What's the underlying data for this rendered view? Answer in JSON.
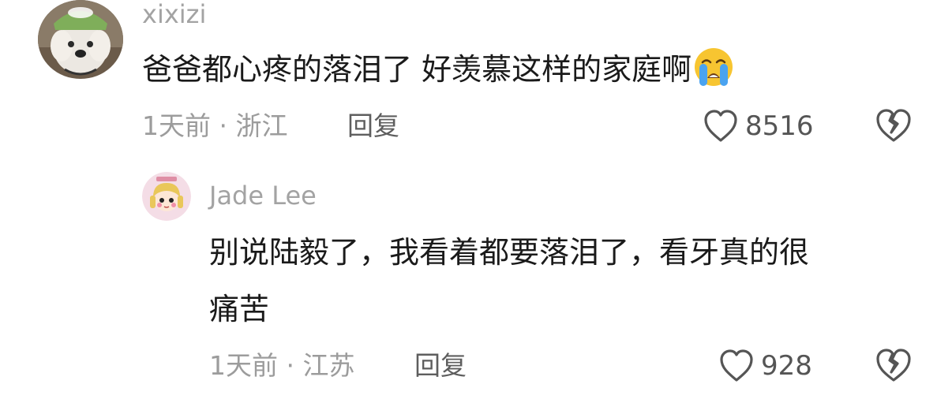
{
  "comments": [
    {
      "username": "xixizi",
      "text": "爸爸都心疼的落泪了 好羡慕这样的家庭啊",
      "emoji": "loudly-crying-face",
      "meta": "1天前 · 浙江",
      "reply_label": "回复",
      "like_count": "8516",
      "avatar_icon": "dog-with-green-cap-avatar"
    },
    {
      "username": "Jade Lee",
      "text_line1": "别说陆毅了，我看着都要落泪了，看牙真的很",
      "text_line2": "痛苦",
      "meta": "1天前 · 江苏",
      "reply_label": "回复",
      "like_count": "928",
      "avatar_icon": "cartoon-girl-avatar"
    }
  ],
  "colors": {
    "username": "#a3a3a3",
    "text": "#1a1a1a",
    "meta": "#9c9c9c",
    "reply": "#5e5e5e",
    "icon": "#555555"
  }
}
